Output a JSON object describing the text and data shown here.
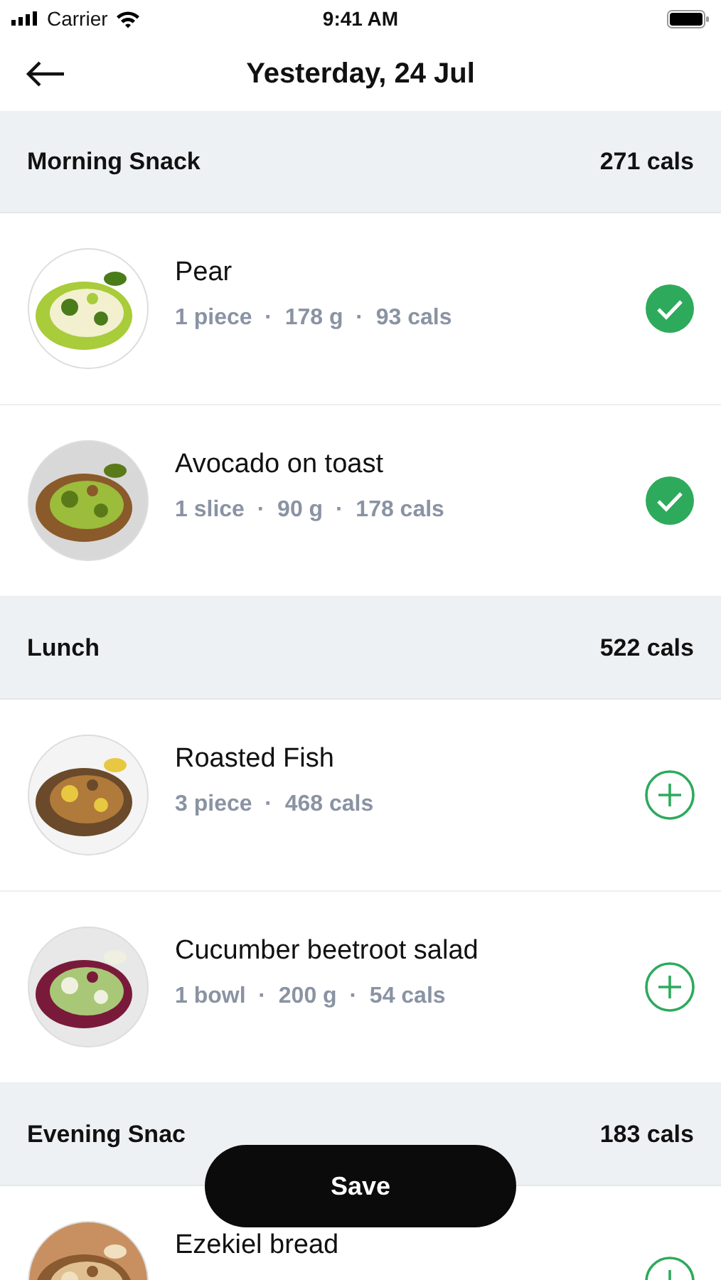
{
  "status_bar": {
    "carrier": "Carrier",
    "time": "9:41 AM"
  },
  "header": {
    "title": "Yesterday, 24 Jul"
  },
  "sections": [
    {
      "name": "Morning Snack",
      "total": "271 cals",
      "items": [
        {
          "name": "Pear",
          "meta": "1 piece  ·  178 g  ·  93 cals",
          "logged": true,
          "kind": "picture"
        },
        {
          "name": "Avocado on toast",
          "meta": "1 slice  ·  90 g  ·  178 cals",
          "logged": true,
          "kind": "picture"
        }
      ]
    },
    {
      "name": "Lunch",
      "total": "522 cals",
      "items": [
        {
          "name": "Roasted Fish",
          "meta": "3 piece  ·  468 cals",
          "logged": false,
          "kind": "picture"
        },
        {
          "name": "Cucumber beetroot salad",
          "meta": "1 bowl  ·  200 g  ·  54 cals",
          "logged": false,
          "kind": "picture"
        }
      ]
    },
    {
      "name": "Evening Snac",
      "total": "183 cals",
      "items": [
        {
          "name": "Ezekiel bread",
          "logged": false,
          "kind": "picture"
        }
      ]
    }
  ],
  "save_button": "Save"
}
